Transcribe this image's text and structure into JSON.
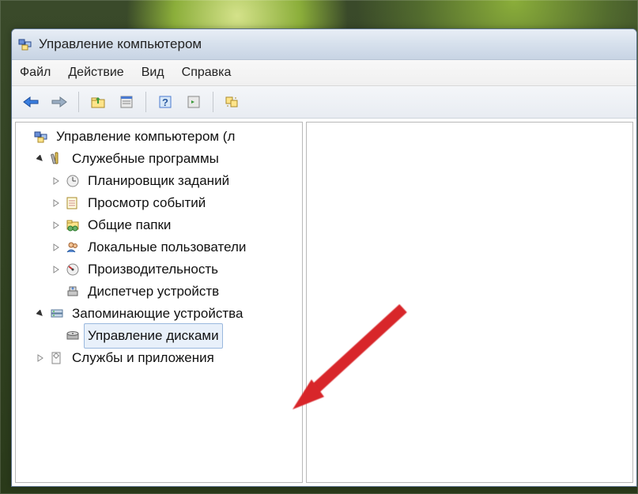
{
  "window": {
    "title": "Управление компьютером"
  },
  "menu": {
    "file": "Файл",
    "action": "Действие",
    "view": "Вид",
    "help": "Справка"
  },
  "toolbar": {
    "back": "back",
    "forward": "forward",
    "up": "up-folder",
    "properties": "properties",
    "help": "help",
    "refresh": "refresh",
    "export": "export"
  },
  "tree": {
    "root": "Управление компьютером (л",
    "systemTools": "Служебные программы",
    "taskScheduler": "Планировщик заданий",
    "eventViewer": "Просмотр событий",
    "sharedFolders": "Общие папки",
    "localUsers": "Локальные пользователи",
    "performance": "Производительность",
    "deviceManager": "Диспетчер устройств",
    "storage": "Запоминающие устройства",
    "diskManagement": "Управление дисками",
    "services": "Службы и приложения"
  }
}
